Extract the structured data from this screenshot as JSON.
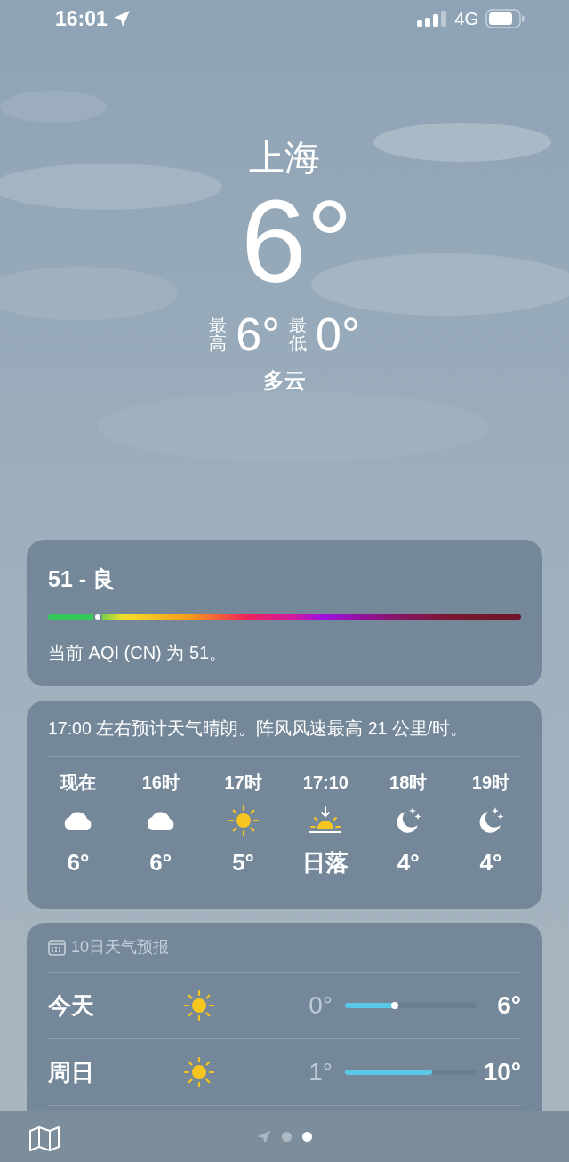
{
  "status_bar": {
    "time": "16:01",
    "network": "4G"
  },
  "header": {
    "city": "上海",
    "temperature": "6°",
    "high_label": "最高",
    "high": "6°",
    "low_label": "最低",
    "low": "0°",
    "condition": "多云"
  },
  "aqi": {
    "title": "51 - 良",
    "level": 0.105,
    "description": "当前 AQI (CN) 为 51。"
  },
  "hourly": {
    "summary": "17:00 左右预计天气晴朗。阵风风速最高 21 公里/时。",
    "items": [
      {
        "time": "现在",
        "kind": "cloud",
        "value": "6°"
      },
      {
        "time": "16时",
        "kind": "cloud",
        "value": "6°"
      },
      {
        "time": "17时",
        "kind": "sun",
        "value": "5°"
      },
      {
        "time": "17:10",
        "kind": "sunset",
        "value": "日落"
      },
      {
        "time": "18时",
        "kind": "moon",
        "value": "4°"
      },
      {
        "time": "19时",
        "kind": "moon",
        "value": "4°"
      }
    ]
  },
  "forecast": {
    "title": "10日天气预报",
    "days": [
      {
        "day": "今天",
        "kind": "sun",
        "low": "0°",
        "high": "6°",
        "level": 0.38,
        "current": true
      },
      {
        "day": "周日",
        "kind": "sun",
        "low": "1°",
        "high": "10°",
        "level": 0.66,
        "current": false
      }
    ]
  },
  "bottom_bar": {
    "pages": [
      {
        "kind": "location",
        "selected": false
      },
      {
        "kind": "dot",
        "selected": false
      },
      {
        "kind": "dot",
        "selected": true
      }
    ]
  }
}
